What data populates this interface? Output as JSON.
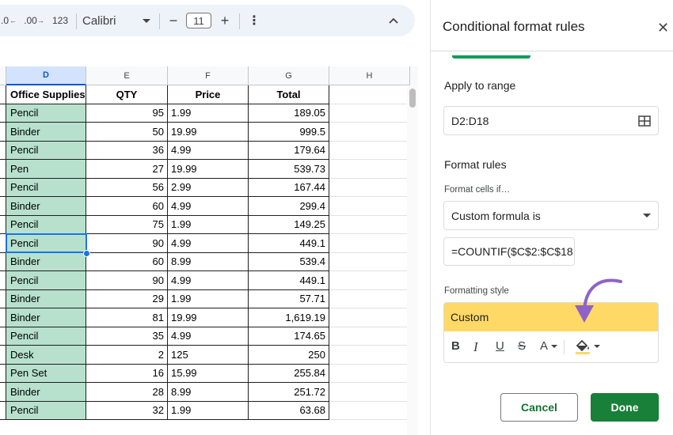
{
  "toolbar": {
    "decrease_decimal": ".0",
    "increase_decimal": ".00",
    "number_format": "123",
    "font_name": "Calibri",
    "font_size": "11",
    "minus": "−",
    "plus": "+",
    "more": "⋮",
    "collapse": "︿"
  },
  "sheet": {
    "columns": [
      "D",
      "E",
      "F",
      "G",
      "H"
    ],
    "selected_column": "D",
    "headers": {
      "D": "Office Supplies",
      "E": "QTY",
      "F": "Price",
      "G": "Total"
    },
    "rows": [
      {
        "D": "Pencil",
        "E": "95",
        "F": "1.99",
        "G": "189.05"
      },
      {
        "D": "Binder",
        "E": "50",
        "F": "19.99",
        "G": "999.5"
      },
      {
        "D": "Pencil",
        "E": "36",
        "F": "4.99",
        "G": "179.64"
      },
      {
        "D": "Pen",
        "E": "27",
        "F": "19.99",
        "G": "539.73"
      },
      {
        "D": "Pencil",
        "E": "56",
        "F": "2.99",
        "G": "167.44"
      },
      {
        "D": "Binder",
        "E": "60",
        "F": "4.99",
        "G": "299.4"
      },
      {
        "D": "Pencil",
        "E": "75",
        "F": "1.99",
        "G": "149.25"
      },
      {
        "D": "Pencil",
        "E": "90",
        "F": "4.99",
        "G": "449.1"
      },
      {
        "D": "Binder",
        "E": "60",
        "F": "8.99",
        "G": "539.4"
      },
      {
        "D": "Pencil",
        "E": "90",
        "F": "4.99",
        "G": "449.1"
      },
      {
        "D": "Binder",
        "E": "29",
        "F": "1.99",
        "G": "57.71"
      },
      {
        "D": "Binder",
        "E": "81",
        "F": "19.99",
        "G": "1,619.19"
      },
      {
        "D": "Pencil",
        "E": "35",
        "F": "4.99",
        "G": "174.65"
      },
      {
        "D": "Desk",
        "E": "2",
        "F": "125",
        "G": "250"
      },
      {
        "D": "Pen Set",
        "E": "16",
        "F": "15.99",
        "G": "255.84"
      },
      {
        "D": "Binder",
        "E": "28",
        "F": "8.99",
        "G": "251.72"
      },
      {
        "D": "Pencil",
        "E": "32",
        "F": "1.99",
        "G": "63.68"
      }
    ]
  },
  "panel": {
    "title": "Conditional format rules",
    "close": "✕",
    "apply_to_range_label": "Apply to range",
    "range_value": "D2:D18",
    "format_rules_label": "Format rules",
    "format_cells_if_label": "Format cells if…",
    "condition_value": "Custom formula is",
    "formula_value": "=COUNTIF($C$2:$C$18",
    "formatting_style_label": "Formatting style",
    "style_preview_text": "Custom",
    "style_buttons": {
      "bold": "B",
      "italic": "I",
      "underline": "U",
      "strike": "S",
      "text_color": "A"
    },
    "cancel_label": "Cancel",
    "done_label": "Done"
  },
  "colors": {
    "highlight_green": "#b7e1cd",
    "style_yellow": "#ffd966",
    "done_green": "#188038",
    "arrow_purple": "#8e63c7",
    "selection_blue": "#1a73e8"
  }
}
